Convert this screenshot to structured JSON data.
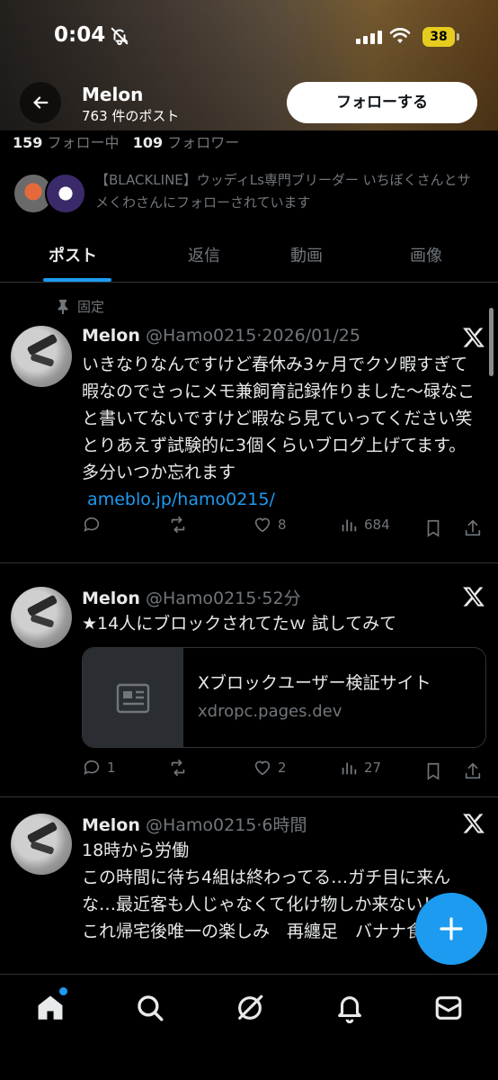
{
  "status_bar": {
    "time": "0:04",
    "battery": "38"
  },
  "header": {
    "name": "Melon",
    "post_count": "763 件のポスト",
    "follow_button": "フォローする"
  },
  "profile": {
    "following_count": "159",
    "following_label": "フォロー中",
    "followers_count": "109",
    "followers_label": "フォロワー",
    "mutual_text": "【BLACKLINE】ウッディLs専門ブリーダー いちぼくさんとサメくわさんにフォローされています"
  },
  "tabs": [
    {
      "label": "ポスト",
      "active": true
    },
    {
      "label": "返信",
      "active": false
    },
    {
      "label": "動画",
      "active": false
    },
    {
      "label": "画像",
      "active": false
    }
  ],
  "posts": [
    {
      "pinned_label": "固定",
      "name": "Melon",
      "handle": "@Hamo0215",
      "time": "2026/01/25",
      "text": "いきなりなんですけど春休み3ヶ月でクソ暇すぎて暇なのでさっにメモ兼飼育記録作りました〜碌なこと書いてないですけど暇なら見ていってください笑　とりあえず試験的に3個くらいブログ上げてます。多分いつか忘れます",
      "link": "ameblo.jp/hamo0215/",
      "replies": "",
      "reposts": "",
      "likes": "8",
      "views": "684"
    },
    {
      "name": "Melon",
      "handle": "@Hamo0215",
      "time": "52分",
      "text": "★14人にブロックされてたｗ 試してみて",
      "card_title": "Xブロックユーザー検証サイト",
      "card_domain": "xdropc.pages.dev",
      "replies": "1",
      "reposts": "",
      "likes": "2",
      "views": "27"
    },
    {
      "name": "Melon",
      "handle": "@Hamo0215",
      "time": "6時間",
      "text_line1": "18時から労働",
      "text_rest": "この時間に待ち4組は終わってる…ガチ目に来んな…最近客も人じゃなくて化け物しか来ない！",
      "text_line3": "これ帰宅後唯一の楽しみ　再纏足　バナナ食"
    }
  ],
  "colors": {
    "accent": "#1d9bf0",
    "background": "#000000",
    "secondary_text": "#71767b",
    "battery": "#e5cc1f"
  },
  "icons": {
    "back": "arrow-left-icon",
    "x_logo": "x-logo-icon",
    "nav": [
      "home-icon",
      "search-icon",
      "grok-icon",
      "bell-icon",
      "mail-icon"
    ]
  }
}
